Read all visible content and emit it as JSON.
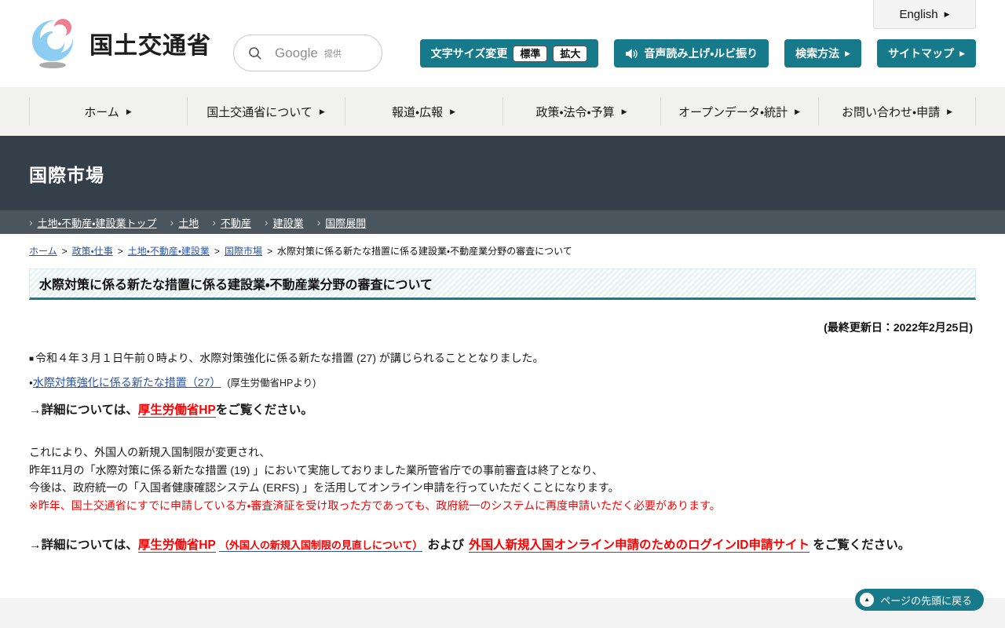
{
  "colors": {
    "teal": "#177a8a",
    "banner_dark": "#343f49",
    "banner_sub": "#4b555e",
    "link_blue": "#2a55a5",
    "alert_red": "#ff0000"
  },
  "header": {
    "english_button": "English",
    "site_name": "国土交通省",
    "search_placeholder_brand": "Google",
    "search_placeholder_note": "提供",
    "font_size_label": "文字サイズ変更",
    "font_size_standard": "標準",
    "font_size_large": "拡大",
    "audio_button": "音声読み上げ・ルビ振り",
    "search_method_button": "検索方法",
    "sitemap_button": "サイトマップ"
  },
  "nav": {
    "items": [
      {
        "label": "ホーム"
      },
      {
        "label": "国土交通省について"
      },
      {
        "label": "報道・広報"
      },
      {
        "label": "政策・法令・予算"
      },
      {
        "label": "オープンデータ・統計"
      },
      {
        "label": "お問い合わせ・申請"
      }
    ]
  },
  "category_banner": {
    "title": "国際市場",
    "links": [
      {
        "label": "土地・不動産・建設業トップ"
      },
      {
        "label": "土地"
      },
      {
        "label": "不動産"
      },
      {
        "label": "建設業"
      },
      {
        "label": "国際展開"
      }
    ]
  },
  "breadcrumb": {
    "links": [
      {
        "label": "ホーム"
      },
      {
        "label": "政策・仕事"
      },
      {
        "label": "土地・不動産・建設業"
      },
      {
        "label": "国際市場"
      }
    ],
    "current": "水際対策に係る新たな措置に係る建設業・不動産業分野の審査について"
  },
  "article": {
    "title": "水際対策に係る新たな措置に係る建設業・不動産業分野の審査について",
    "last_updated": "(最終更新日：2022年2月25日)",
    "notice": {
      "bullet": "■",
      "text": "令和４年３月１日午前０時より、水際対策強化に係る新たな措置 (27) が講じられることとなりました。"
    },
    "measure_link": {
      "bullet": "・",
      "link": "水際対策強化に係る新たな措置（27）",
      "note": "(厚生労働省HPより)"
    },
    "detail1": {
      "prefix": "→詳細については、",
      "link": "厚生労働省HP",
      "suffix": "をご覧ください。"
    },
    "paragraph": [
      "これにより、外国人の新規入国制限が変更され、",
      "昨年11月の「水際対策に係る新たな措置 (19) 」において実施しておりました業所管省庁での事前審査は終了となり、",
      "今後は、政府統一の「入国者健康確認システム (ERFS) 」を活用してオンライン申請を行っていただくことになります。"
    ],
    "warning": "※昨年、国土交通省にすでに申請している方・審査済証を受け取った方であっても、政府統一のシステムに再度申請いただく必要があります。",
    "detail2": {
      "prefix": "→詳細については、",
      "link1": "厚生労働省HP",
      "link1_note": "（外国人の新規入国制限の見直しについて）",
      "middle": "および",
      "link2": "外国人新規入国オンライン申請のためのログインID申請サイト",
      "suffix": "をご覧ください。"
    }
  },
  "back_to_top": "ページの先頭に戻る",
  "icons": {
    "arrow_right": "▶",
    "chevron": "›",
    "separator": ">",
    "up_triangle": "▲"
  }
}
